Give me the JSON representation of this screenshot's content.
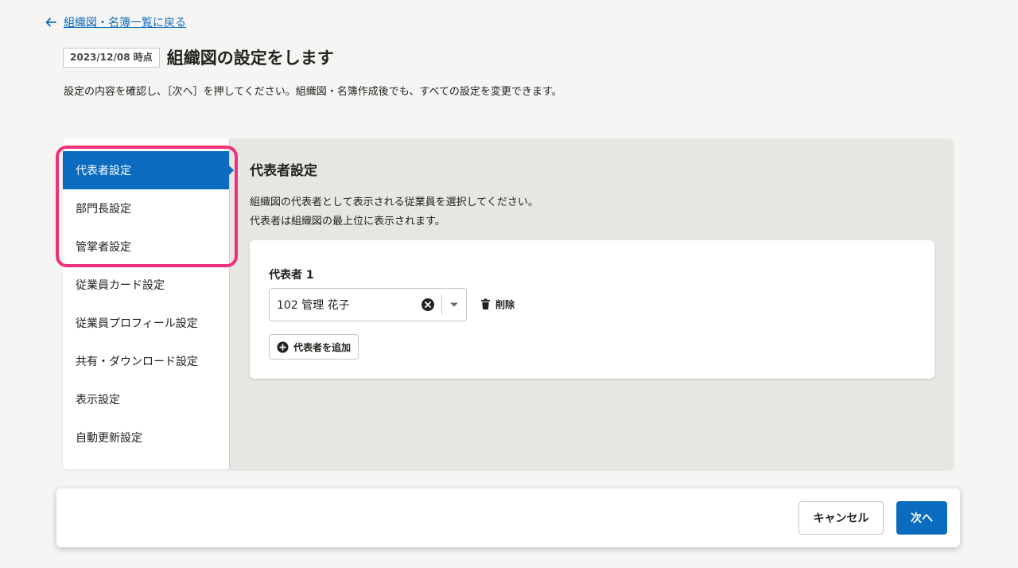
{
  "back_link": {
    "label": "組織図・名簿一覧に戻る",
    "icon": "arrow-left-icon"
  },
  "header": {
    "date_badge": "2023/12/08 時点",
    "title": "組織図の設定をします"
  },
  "description": "設定の内容を確認し、［次へ］を押してください。組織図・名簿作成後でも、すべての設定を変更できます。",
  "sidebar": {
    "items": [
      {
        "label": "代表者設定",
        "active": true
      },
      {
        "label": "部門長設定",
        "active": false
      },
      {
        "label": "管掌者設定",
        "active": false
      },
      {
        "label": "従業員カード設定",
        "active": false
      },
      {
        "label": "従業員プロフィール設定",
        "active": false
      },
      {
        "label": "共有・ダウンロード設定",
        "active": false
      },
      {
        "label": "表示設定",
        "active": false
      },
      {
        "label": "自動更新設定",
        "active": false
      }
    ]
  },
  "main": {
    "section_title": "代表者設定",
    "section_desc_line1": "組織図の代表者として表示される従業員を選択してください。",
    "section_desc_line2": "代表者は組織図の最上位に表示されます。",
    "representative": {
      "label": "代表者 1",
      "selected_value": "102 管理 花子",
      "delete_label": "削除",
      "add_label": "代表者を追加"
    }
  },
  "footer": {
    "cancel_label": "キャンセル",
    "next_label": "次へ"
  },
  "colors": {
    "accent": "#0b6bbf",
    "highlight": "#f0307a",
    "background": "#f6f5f4",
    "panel": "#e8e6e2"
  }
}
